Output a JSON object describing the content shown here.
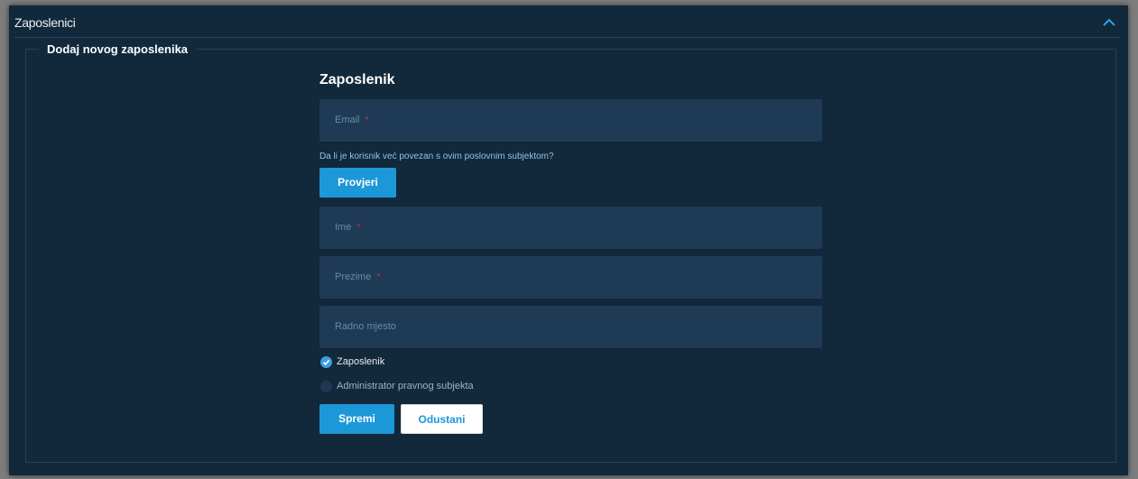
{
  "panel": {
    "title": "Zaposlenici",
    "collapse_icon": "chevron-up-icon"
  },
  "section": {
    "legend": "Dodaj novog zaposlenika"
  },
  "form": {
    "title": "Zaposlenik",
    "email": {
      "placeholder": "Email",
      "required_mark": "*",
      "value": ""
    },
    "check_hint": "Da li je korisnik već povezan s ovim poslovnim subjektom?",
    "check_button": "Provjeri",
    "first_name": {
      "placeholder": "Ime",
      "required_mark": "*",
      "value": ""
    },
    "last_name": {
      "placeholder": "Prezime",
      "required_mark": "*",
      "value": ""
    },
    "job_title": {
      "placeholder": "Radno mjesto",
      "value": ""
    },
    "roles": [
      {
        "label": "Zaposlenik",
        "checked": true
      },
      {
        "label": "Administrator pravnog subjekta",
        "checked": false
      }
    ],
    "save_button": "Spremi",
    "cancel_button": "Odustani"
  },
  "colors": {
    "panel_bg": "#12283b",
    "field_bg": "#1f3a55",
    "accent": "#1c98d8",
    "required": "#b5354b"
  }
}
